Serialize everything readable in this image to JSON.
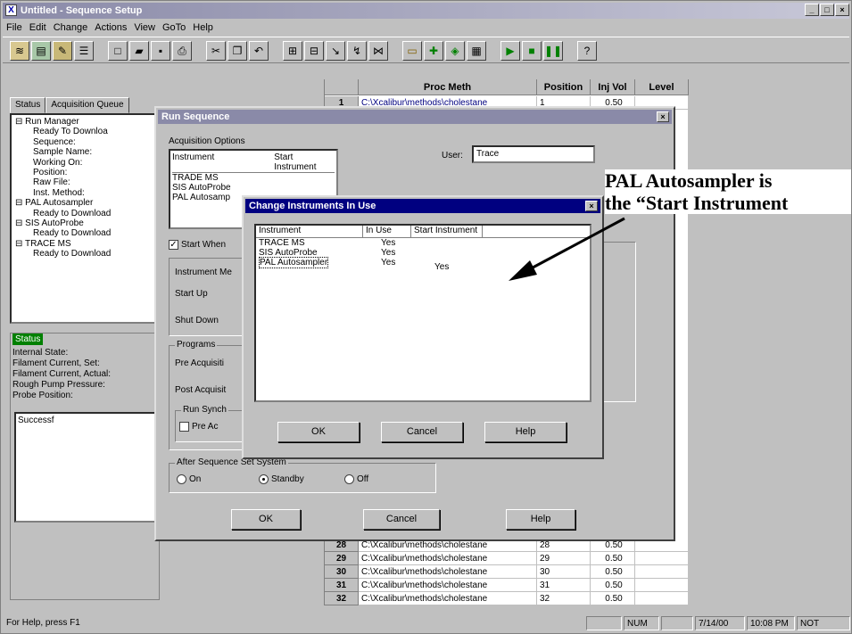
{
  "window": {
    "title": "Untitled - Sequence Setup",
    "app_icon": "X",
    "controls": [
      "_",
      "□",
      "×"
    ]
  },
  "menu": [
    "File",
    "Edit",
    "Change",
    "Actions",
    "View",
    "GoTo",
    "Help"
  ],
  "toolbar": {
    "icons": [
      "tune-icon",
      "instrument-icon",
      "sample-icon",
      "list-icon",
      "new-icon",
      "open-icon",
      "save-icon",
      "print-icon",
      "cut-icon",
      "copy-icon",
      "paste-icon",
      "insert-icon",
      "fill-icon",
      "tray-icon",
      "calibrate-icon",
      "view-icon",
      "probe-icon",
      "add-icon",
      "up-icon",
      "table-icon",
      "run-icon",
      "stop-icon",
      "pause-icon",
      "help-icon"
    ]
  },
  "left_pane": {
    "tabs": [
      "Status",
      "Acquisition Queue"
    ],
    "tree": [
      {
        "text": "Run Manager",
        "level": 0
      },
      {
        "text": "Ready To Downloa",
        "level": 1
      },
      {
        "text": "Sequence:",
        "level": 1
      },
      {
        "text": "Sample Name:",
        "level": 1
      },
      {
        "text": "Working On:",
        "level": 1
      },
      {
        "text": "Position:",
        "level": 1
      },
      {
        "text": "Raw File:",
        "level": 1
      },
      {
        "text": "Inst. Method:",
        "level": 1
      },
      {
        "text": "PAL Autosampler",
        "level": 0
      },
      {
        "text": "Ready to Download",
        "level": 1
      },
      {
        "text": "SIS AutoProbe",
        "level": 0
      },
      {
        "text": "Ready to Download",
        "level": 1
      },
      {
        "text": "TRACE MS",
        "level": 0
      },
      {
        "text": "Ready to Download",
        "level": 1
      }
    ],
    "status_label": "Status",
    "status_rows": [
      "Internal State:",
      "Filament Current, Set:",
      "Filament Current, Actual:",
      "Rough Pump Pressure:",
      "Probe Position:"
    ],
    "message": "Successf"
  },
  "grid": {
    "columns": [
      "",
      "Proc Meth",
      "Position",
      "Inj Vol",
      "Level"
    ],
    "rows": [
      {
        "n": "1",
        "meth": "C:\\Xcalibur\\methods\\cholestane",
        "pos": "1",
        "vol": "0.50",
        "level": ""
      },
      {
        "n": "28",
        "meth": "C:\\Xcalibur\\methods\\cholestane",
        "pos": "28",
        "vol": "0.50",
        "level": ""
      },
      {
        "n": "29",
        "meth": "C:\\Xcalibur\\methods\\cholestane",
        "pos": "29",
        "vol": "0.50",
        "level": ""
      },
      {
        "n": "30",
        "meth": "C:\\Xcalibur\\methods\\cholestane",
        "pos": "30",
        "vol": "0.50",
        "level": ""
      },
      {
        "n": "31",
        "meth": "C:\\Xcalibur\\methods\\cholestane",
        "pos": "31",
        "vol": "0.50",
        "level": ""
      },
      {
        "n": "32",
        "meth": "C:\\Xcalibur\\methods\\cholestane",
        "pos": "32",
        "vol": "0.50",
        "level": ""
      }
    ]
  },
  "run_sequence": {
    "title": "Run Sequence",
    "acq_options_label": "Acquisition Options",
    "col_instrument": "Instrument",
    "col_start": "Start Instrument",
    "instruments": [
      "TRADE MS",
      "SIS AutoProbe",
      "PAL Autosamp"
    ],
    "user_label": "User:",
    "user_value": "Trace",
    "start_when_label": "Start When",
    "instr_methods_label": "Instrument Me",
    "startup_label": "Start Up",
    "shutdown_label": "Shut Down",
    "programs_label": "Programs",
    "pre_acq_label": "Pre Acquisiti",
    "post_acq_label": "Post Acquisit",
    "run_synch_label": "Run Synch",
    "pre_acq_chk": "Pre Ac",
    "after_label": "After Sequence Set System",
    "radio_on": "On",
    "radio_standby": "Standby",
    "radio_off": "Off",
    "ok": "OK",
    "cancel": "Cancel",
    "help": "Help"
  },
  "change_instruments": {
    "title": "Change Instruments In Use",
    "columns": [
      "Instrument",
      "In Use",
      "Start Instrument"
    ],
    "rows": [
      {
        "name": "TRACE MS",
        "in_use": "Yes",
        "start": ""
      },
      {
        "name": "SIS AutoProbe",
        "in_use": "Yes",
        "start": ""
      },
      {
        "name": "PAL Autosampler",
        "in_use": "Yes",
        "start": "Yes"
      }
    ],
    "ok": "OK",
    "cancel": "Cancel",
    "help": "Help"
  },
  "statusbar": {
    "help_text": "For Help, press F1",
    "num": "NUM",
    "date": "7/14/00",
    "time": "10:08 PM",
    "saved": "NOT SAVED"
  },
  "annotation": {
    "line1": "PAL Autosampler is",
    "line2": "the “Start Instrument"
  },
  "colors": {
    "dialog_title": "#000080",
    "inactive_title": "#8a8aa8",
    "status_green": "#008000"
  }
}
